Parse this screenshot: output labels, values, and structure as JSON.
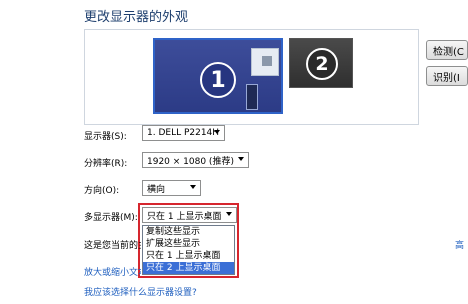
{
  "page": {
    "title": "更改显示器的外观"
  },
  "preview": {
    "monitors": [
      {
        "number": "1"
      },
      {
        "number": "2"
      }
    ]
  },
  "buttons": {
    "detect": "检测(C",
    "identify": "识别(I"
  },
  "settings": {
    "display": {
      "label": "显示器(S):",
      "value": "1. DELL P2214H"
    },
    "resolution": {
      "label": "分辨率(R):",
      "value": "1920 × 1080 (推荐)"
    },
    "orientation": {
      "label": "方向(O):",
      "value": "横向"
    },
    "multi": {
      "label": "多显示器(M):",
      "value": "只在 1 上显示桌面"
    }
  },
  "dropdown": {
    "options": [
      "复制这些显示",
      "扩展这些显示",
      "只在 1 上显示桌面",
      "只在 2 上显示桌面"
    ],
    "selected_index": 3
  },
  "notes": {
    "current": "这是您当前的主"
  },
  "links": {
    "advanced": "高",
    "zoom_text": "放大或缩小文本",
    "which_settings": "我应该选择什么显示器设置?"
  },
  "colors": {
    "highlight": "#d6262e",
    "selection": "#3b6fd6",
    "link": "#1f5fbf"
  }
}
